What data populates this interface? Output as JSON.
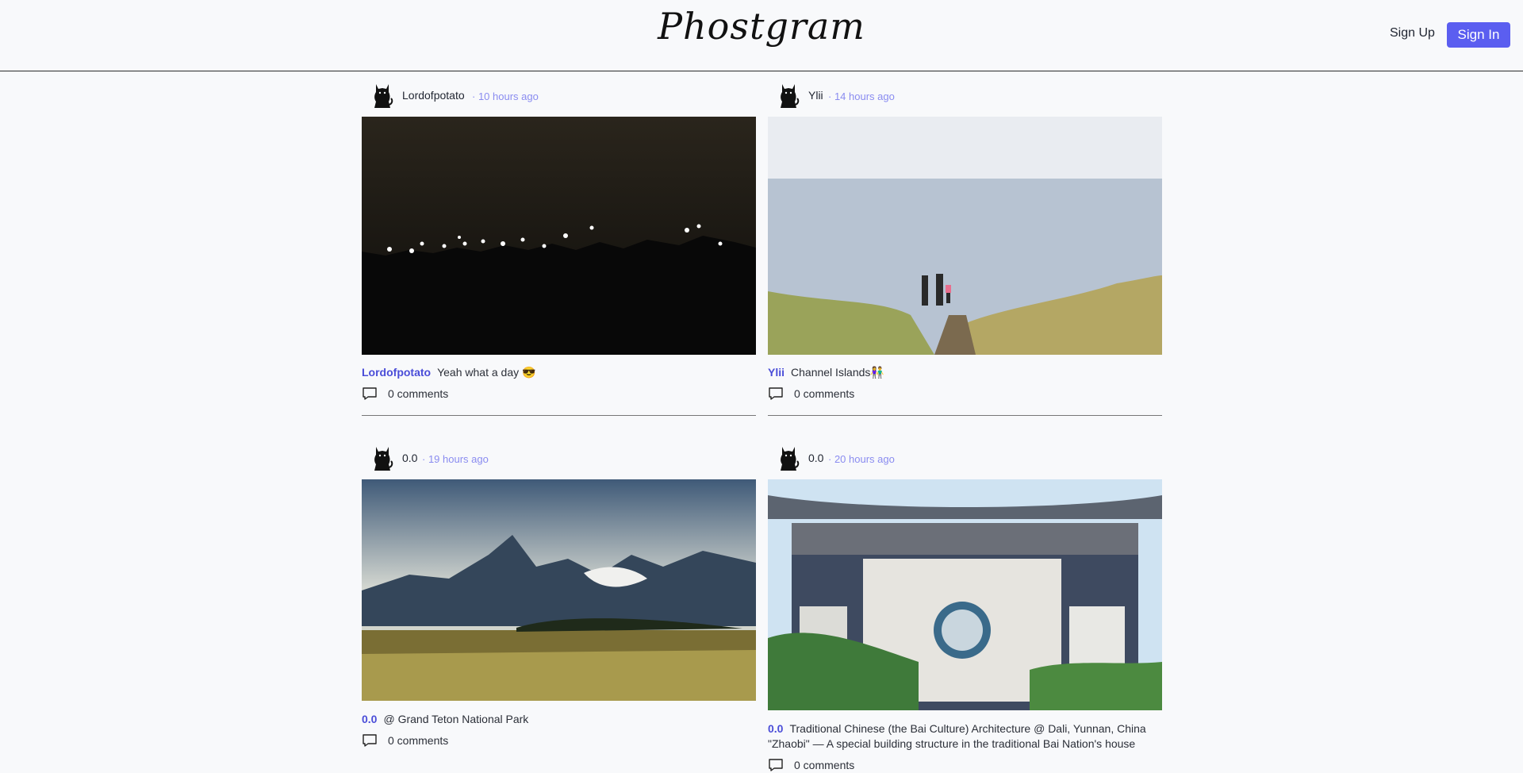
{
  "app": {
    "logo": "Phostgram"
  },
  "header": {
    "signup_label": "Sign Up",
    "signin_label": "Sign In"
  },
  "posts": [
    {
      "author": "Lordofpotato",
      "time": "· 10 hours ago",
      "caption": "Yeah what a day 😎",
      "comments": "0 comments"
    },
    {
      "author": "Ylii",
      "time": "· 14 hours ago",
      "caption": "Channel Islands👫",
      "comments": "0 comments"
    },
    {
      "author": "0.0",
      "time": "· 19 hours ago",
      "caption": "@ Grand Teton National Park",
      "comments": "0 comments"
    },
    {
      "author": "0.0",
      "time": "· 20 hours ago",
      "caption_line1": "Traditional Chinese (the Bai Culture) Architecture @ Dali, Yunnan, China",
      "caption_line2": "\"Zhaobi\" — A special building structure in the traditional Bai Nation's house",
      "comments": "0 comments"
    }
  ]
}
